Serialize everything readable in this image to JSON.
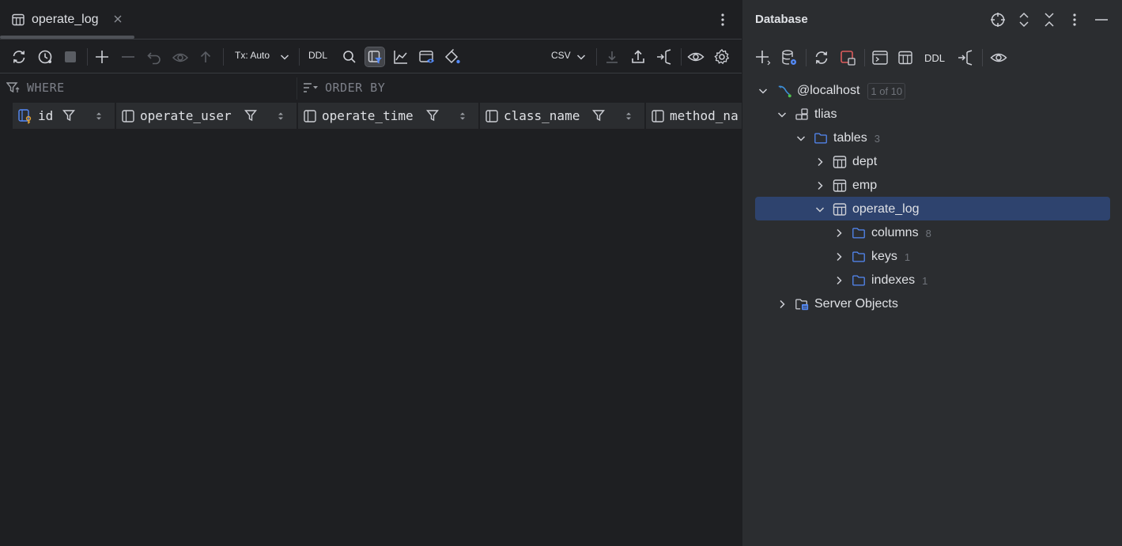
{
  "editor": {
    "tab": {
      "label": "operate_log",
      "icon": "table-icon"
    },
    "toolbar": {
      "tx_label": "Tx: Auto",
      "ddl_label": "DDL",
      "export_format": "CSV"
    },
    "filter": {
      "where_label": "WHERE",
      "order_label": "ORDER BY"
    },
    "columns": [
      {
        "label": "id",
        "icon": "primary-key-column-icon"
      },
      {
        "label": "operate_user",
        "icon": "column-icon"
      },
      {
        "label": "operate_time",
        "icon": "column-icon"
      },
      {
        "label": "class_name",
        "icon": "column-icon"
      },
      {
        "label": "method_na",
        "icon": "column-icon"
      }
    ]
  },
  "database": {
    "title": "Database",
    "toolbar": {
      "ddl_label": "DDL"
    },
    "tree": {
      "host": {
        "label": "@localhost",
        "badge": "1 of 10"
      },
      "schema": {
        "label": "tlias"
      },
      "tables": {
        "label": "tables",
        "count": "3"
      },
      "table_dept": {
        "label": "dept"
      },
      "table_emp": {
        "label": "emp"
      },
      "table_operate_log": {
        "label": "operate_log"
      },
      "columns": {
        "label": "columns",
        "count": "8"
      },
      "keys": {
        "label": "keys",
        "count": "1"
      },
      "indexes": {
        "label": "indexes",
        "count": "1"
      },
      "server_objects": {
        "label": "Server Objects"
      }
    }
  },
  "colors": {
    "background": "#1e1f22",
    "panel": "#2b2d30",
    "selection": "#2e436e",
    "folder_blue": "#548af7",
    "text": "#dfe1e5",
    "muted": "#6f737a"
  }
}
